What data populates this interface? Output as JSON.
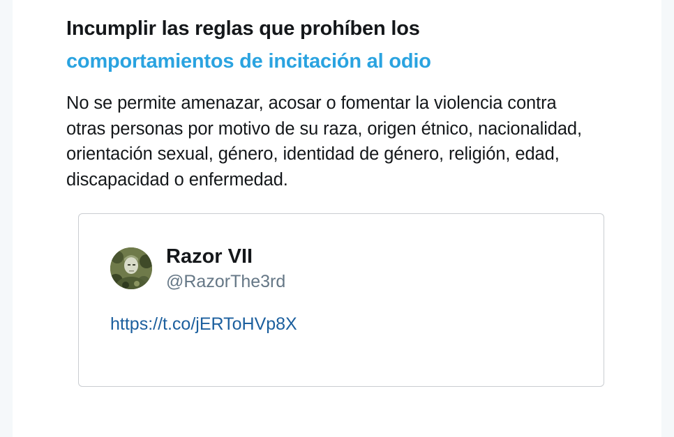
{
  "rule": {
    "title_line1": "Incumplir las reglas que prohíben los",
    "title_line2_link": "comportamientos de incitación al odio",
    "description": "No se permite amenazar, acosar o fomentar la violencia contra otras personas por motivo de su raza, origen étnico, nacionalidad, orientación sexual, género, identidad de género, religión, edad, discapacidad o enfermedad."
  },
  "tweet": {
    "display_name": "Razor VII",
    "handle": "@RazorThe3rd",
    "link_text": "https://t.co/jERToHVp8X",
    "avatar_icon": "user-avatar-camo"
  },
  "colors": {
    "accent": "#2aa3e0",
    "link": "#1b5f9e",
    "text": "#14171a",
    "muted": "#657786",
    "border": "#c9cdd1"
  }
}
